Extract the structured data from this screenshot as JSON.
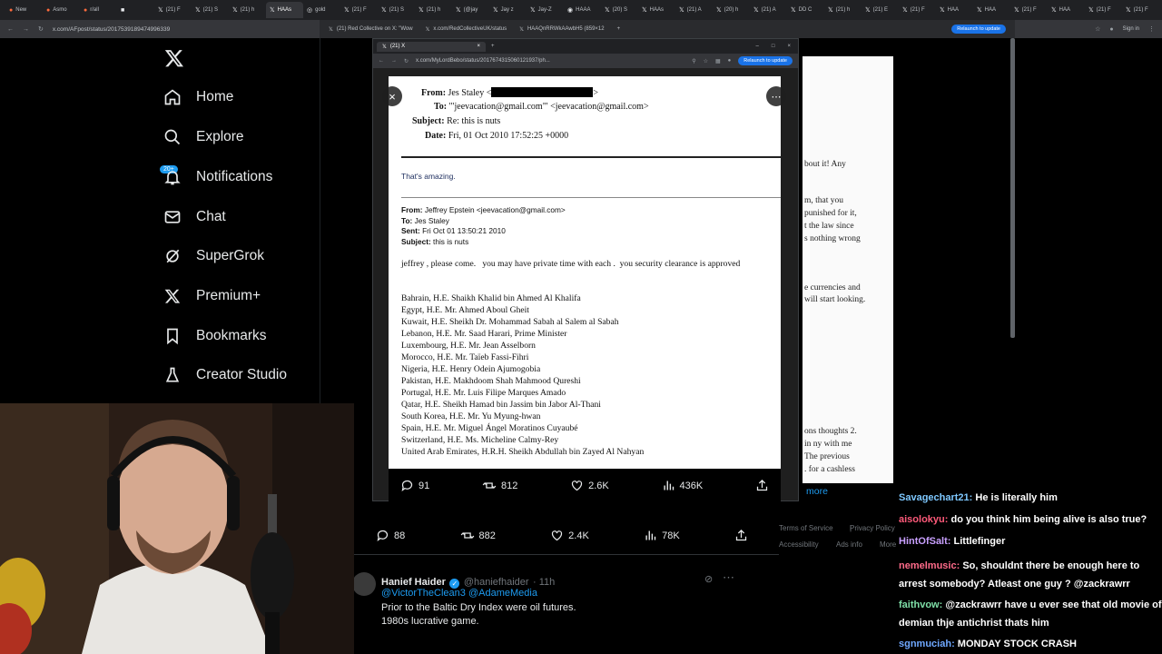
{
  "browser": {
    "tabs": [
      {
        "icon": "reddit",
        "label": "New"
      },
      {
        "icon": "reddit",
        "label": "Asmo"
      },
      {
        "icon": "reddit",
        "label": "r/all"
      },
      {
        "icon": "square",
        "label": ""
      },
      {
        "icon": "x",
        "label": "(21) F"
      },
      {
        "icon": "x",
        "label": "(21) S"
      },
      {
        "icon": "x",
        "label": "(21) h"
      },
      {
        "icon": "x",
        "label": "HAAs"
      },
      {
        "icon": "globe",
        "label": "gold"
      },
      {
        "icon": "x",
        "label": "(21) F"
      },
      {
        "icon": "x",
        "label": "(21) S"
      },
      {
        "icon": "x",
        "label": "(21) h"
      },
      {
        "icon": "x",
        "label": "(@jay"
      },
      {
        "icon": "x",
        "label": "Jay z"
      },
      {
        "icon": "x",
        "label": "Jay-Z"
      },
      {
        "icon": "insta",
        "label": "HAAA"
      },
      {
        "icon": "x",
        "label": "(20) S"
      },
      {
        "icon": "x",
        "label": "HAAs"
      },
      {
        "icon": "x",
        "label": "(21) A"
      },
      {
        "icon": "x",
        "label": "(20) h"
      },
      {
        "icon": "x",
        "label": "(21) A"
      },
      {
        "icon": "x",
        "label": "DD C"
      },
      {
        "icon": "x",
        "label": "(21) h"
      },
      {
        "icon": "x",
        "label": "(21) E"
      },
      {
        "icon": "x",
        "label": "(21) F"
      },
      {
        "icon": "x",
        "label": "HAA"
      },
      {
        "icon": "x",
        "label": "HAA"
      },
      {
        "icon": "x",
        "label": "(21) F"
      },
      {
        "icon": "x",
        "label": "HAA"
      },
      {
        "icon": "x",
        "label": "(21) F"
      },
      {
        "icon": "x",
        "label": "(21) F"
      }
    ],
    "url": "x.com/AFpost/status/2017539189474996339",
    "signin_label": "Sign in"
  },
  "back_window": {
    "tabs": [
      "(21) Red Collective on X: \"Wow",
      "x.com/RedCollectiveUK/status",
      "HAAQnRRWkAAwbH5 (859×12"
    ],
    "relaunch_label": "Relaunch to update"
  },
  "inner_window": {
    "tab_label": "(21) X",
    "url": "x.com/MyLordBebo/status/2017674315060121937/ph...",
    "relaunch_label": "Relaunch to update"
  },
  "sidebar": {
    "items": [
      {
        "label": "Home",
        "icon": "home-icon"
      },
      {
        "label": "Explore",
        "icon": "search-icon"
      },
      {
        "label": "Notifications",
        "icon": "bell-icon"
      },
      {
        "label": "Chat",
        "icon": "mail-icon"
      },
      {
        "label": "SuperGrok",
        "icon": "grok-icon"
      },
      {
        "label": "Premium+",
        "icon": "x-icon"
      },
      {
        "label": "Bookmarks",
        "icon": "bookmark-icon"
      },
      {
        "label": "Creator Studio",
        "icon": "flask-icon"
      }
    ],
    "notifications_badge": "20+"
  },
  "document": {
    "from_label": "From:",
    "from_value": "Jes Staley <",
    "from_value_end": ">",
    "to_label": "To:",
    "to_value": "'\"jeevacation@gmail.com\"' <jeevacation@gmail.com>",
    "subject_label": "Subject:",
    "subject_value": "Re: this is nuts",
    "date_label": "Date:",
    "date_value": "Fri, 01 Oct 2010 17:52:25 +0000",
    "reply_text": "That's amazing.",
    "orig_from_label": "From:",
    "orig_from_value": "Jeffrey Epstein <jeevacation@gmail.com>",
    "orig_to_label": "To:",
    "orig_to_value": "Jes Staley",
    "orig_sent_label": "Sent:",
    "orig_sent_value": "Fri Oct 01 13:50:21 2010",
    "orig_subject_label": "Subject:",
    "orig_subject_value": "this is nuts",
    "body": "jeffrey , please come.   you may have private time with each .  you security clearance is approved",
    "countries": [
      "Bahrain, H.E. Shaikh Khalid bin Ahmed Al Khalifa",
      "Egypt, H.E. Mr. Ahmed Aboul Gheit",
      "Kuwait, H.E. Sheikh Dr. Mohammad Sabah al Salem al Sabah",
      "Lebanon, H.E. Mr. Saad Harari, Prime Minister",
      "Luxembourg, H.E. Mr. Jean Asselborn",
      "Morocco, H.E. Mr. Taïeb Fassi-Fihri",
      "Nigeria, H.E. Henry Odein Ajumogobia",
      "Pakistan, H.E. Makhdoom Shah Mahmood Qureshi",
      "Portugal, H.E. Mr. Luis Filipe Marques Amado",
      "Qatar, H.E. Sheikh Hamad bin Jassim bin Jabor Al-Thani",
      "South Korea, H.E. Mr. Yu Myung-hwan",
      "Spain, H.E. Mr. Miguel Ángel Moratinos Cuyaubé",
      "Switzerland, H.E. Ms. Micheline Calmy-Rey",
      "United Arab Emirates, H.R.H. Sheikh Abdullah bin Zayed Al Nahyan"
    ]
  },
  "photo_actions": {
    "replies": "91",
    "reposts": "812",
    "likes": "2.6K",
    "views": "436K"
  },
  "tweet_actions": {
    "replies": "88",
    "reposts": "882",
    "likes": "2.4K",
    "views": "78K"
  },
  "reply_tweet": {
    "name": "Hanief Haider",
    "handle": "@haniefhaider",
    "time": "· 11h",
    "mentions": "@VictorTheClean3 @AdameMedia",
    "line1": "Prior to the Baltic Dry Index were oil futures.",
    "line2": "1980s lucrative game."
  },
  "right_doc": {
    "lines": [
      "bout it! Any",
      "m, that you",
      " punished for it,",
      "t the law since",
      "s nothing wrong",
      "e currencies and",
      " will start looking.",
      "ons thoughts  2.",
      " in ny with me",
      " The previous",
      ". for a cashless"
    ],
    "show_more": "more"
  },
  "footer_links": [
    "Terms of Service",
    "Privacy Policy",
    "Accessibility",
    "Ads info",
    "More"
  ],
  "chat": [
    {
      "user": "Savagechart21:",
      "color": "#7ec8ff",
      "text": "He is literally him"
    },
    {
      "user": "aisolokyu:",
      "color": "#ff5a7a",
      "text": "do you think him being alive is also true?"
    },
    {
      "user": "HintOfSalt:",
      "color": "#c9a0ff",
      "text": "Littlefinger"
    },
    {
      "user": "nemelmusic:",
      "color": "#ff6b8a",
      "text": "So, shouldnt there be enough here to arrest somebody? Atleast one guy ? @zackrawrr"
    },
    {
      "user": "faithvow:",
      "color": "#7fe0a8",
      "text": "@zackrawrr have u ever see that old movie of demian thje antichrist thats him"
    },
    {
      "user": "sgnmuciah:",
      "color": "#6fa8ff",
      "text": "MONDAY STOCK CRASH"
    }
  ]
}
